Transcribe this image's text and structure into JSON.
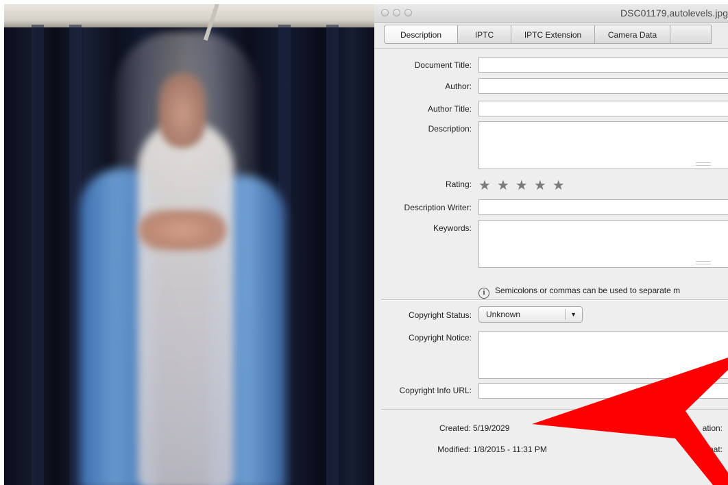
{
  "window": {
    "title": "DSC01179,autolevels.jpg"
  },
  "tabs": [
    {
      "label": "Description",
      "active": true
    },
    {
      "label": "IPTC",
      "active": false
    },
    {
      "label": "IPTC Extension",
      "active": false
    },
    {
      "label": "Camera Data",
      "active": false
    }
  ],
  "form": {
    "document_title_label": "Document Title:",
    "document_title_value": "",
    "author_label": "Author:",
    "author_value": "",
    "author_title_label": "Author Title:",
    "author_title_value": "",
    "description_label": "Description:",
    "description_value": "",
    "rating_label": "Rating:",
    "rating_value": 0,
    "rating_max": 5,
    "description_writer_label": "Description Writer:",
    "description_writer_value": "",
    "keywords_label": "Keywords:",
    "keywords_value": "",
    "keywords_hint": "Semicolons or commas can be used to separate m",
    "copyright_status_label": "Copyright Status:",
    "copyright_status_value": "Unknown",
    "copyright_notice_label": "Copyright Notice:",
    "copyright_notice_value": "",
    "copyright_info_url_label": "Copyright Info URL:",
    "copyright_info_url_value": ""
  },
  "metadata": {
    "created_label": "Created:",
    "created_value": "5/19/2029",
    "modified_label": "Modified:",
    "modified_value": "1/8/2015 - 11:31 PM",
    "right_label_1": "ation:",
    "right_label_2": "mat:"
  },
  "colors": {
    "annotation_arrow": "#ff0000",
    "mantle_blue": "#5b90d0",
    "curtain": "#0f1322"
  },
  "icons": {
    "info": "info-circle-icon",
    "star": "star-icon",
    "dropdown": "chevron-down-icon"
  }
}
